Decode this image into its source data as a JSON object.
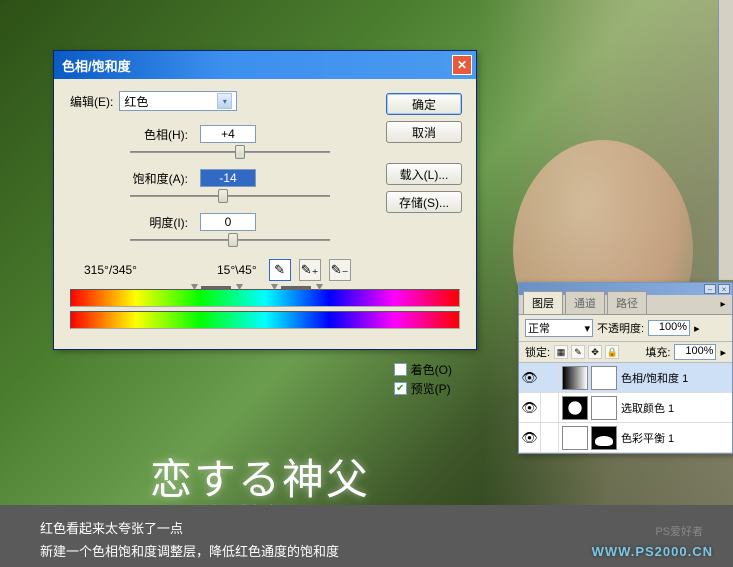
{
  "dialog": {
    "title": "色相/饱和度",
    "edit_label": "编辑(E):",
    "edit_value": "红色",
    "hue_label": "色相(H):",
    "hue_value": "+4",
    "sat_label": "饱和度(A):",
    "sat_value": "-14",
    "light_label": "明度(I):",
    "light_value": "0",
    "degree_left": "315°/345°",
    "degree_right": "15°\\45°",
    "colorize_label": "着色(O)",
    "preview_label": "预览(P)",
    "buttons": {
      "ok": "确定",
      "cancel": "取消",
      "load": "载入(L)...",
      "save": "存储(S)..."
    }
  },
  "layers": {
    "tabs": [
      "图层",
      "通道",
      "路径"
    ],
    "blend_label": "正常",
    "opacity_label": "不透明度:",
    "opacity_value": "100%",
    "lock_label": "锁定:",
    "fill_label": "填充:",
    "fill_value": "100%",
    "items": [
      {
        "name": "色相/饱和度 1"
      },
      {
        "name": "选取颜色 1"
      },
      {
        "name": "色彩平衡 1"
      }
    ]
  },
  "caption": {
    "line1": "红色看起来太夸张了一点",
    "line2": "新建一个色相饱和度调整层，降低红色通度的饱和度"
  },
  "watermark": {
    "label": "PS爱好者",
    "url": "WWW.PS2000.CN"
  },
  "movie": {
    "title": "恋する神父",
    "subtitle": "Love So Divine"
  }
}
